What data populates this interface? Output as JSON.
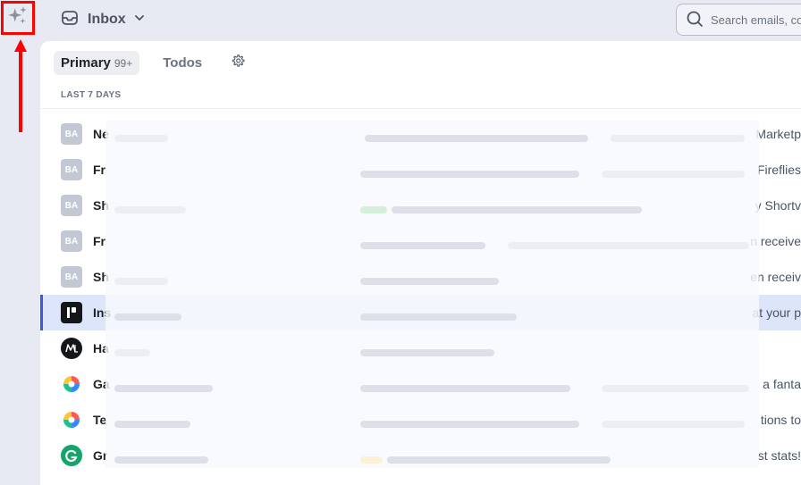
{
  "sidebar": {
    "sparkle_icon": "sparkle-icon",
    "highlight_color": "#ff0000"
  },
  "topbar": {
    "inbox_label": "Inbox",
    "search_placeholder": "Search emails, co"
  },
  "tabs": {
    "primary_label": "Primary",
    "primary_count": "99+",
    "todos_label": "Todos"
  },
  "section_label": "LAST 7 DAYS",
  "emails": [
    {
      "avatar": "BA",
      "sender": "Ne",
      "tail": "Marketp"
    },
    {
      "avatar": "BA",
      "sender": "Fr",
      "tail": "Fireflies"
    },
    {
      "avatar": "BA",
      "sender": "Sh",
      "tail": "y Shortv"
    },
    {
      "avatar": "BA",
      "sender": "Fr",
      "tail": "n receive"
    },
    {
      "avatar": "BA",
      "sender": "Sh",
      "tail": "en receiv"
    },
    {
      "avatar": "",
      "sender": "Ins",
      "tail": "at your p"
    },
    {
      "avatar": "",
      "sender": "Ha",
      "tail": ""
    },
    {
      "avatar": "",
      "sender": "Ga",
      "tail": "a fanta"
    },
    {
      "avatar": "",
      "sender": "Te",
      "tail": "tions to"
    },
    {
      "avatar": "",
      "sender": "Gr",
      "tail": "st stats! "
    }
  ],
  "colors": {
    "accent": "#3b5bdb",
    "selected_row": "#dde5fb",
    "canvas_bg": "#e7e9f3"
  }
}
